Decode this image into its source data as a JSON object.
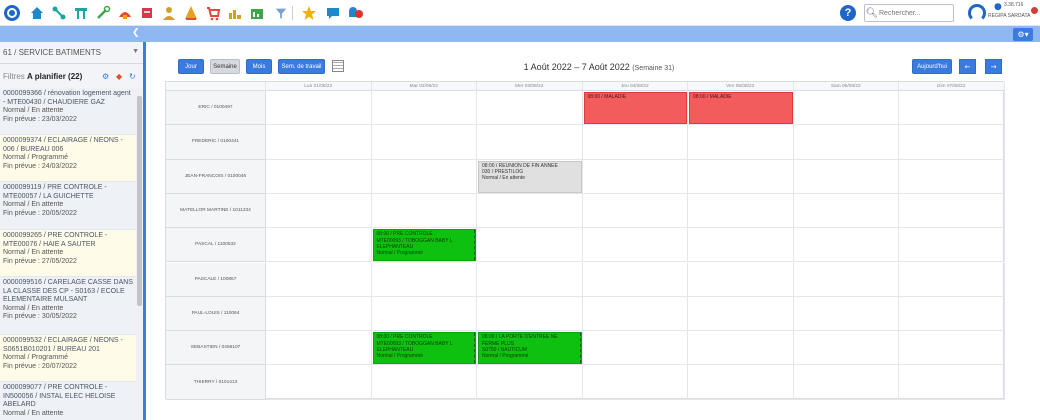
{
  "search": {
    "placeholder": "Rechercher..."
  },
  "user": {
    "version": "3.38.716",
    "name": "REGIPA   SARDATA"
  },
  "sidebar": {
    "service": "61 / SERVICE BATIMENTS",
    "filter_prefix": "Filtres",
    "filter_label": "A planifier (22)",
    "tasks": [
      {
        "title": "0000099366 / rénovation logement agent - MTE00430 / CHAUDIERE GAZ",
        "status": "Normal / En attente",
        "end": "Fin prévue : 23/03/2022"
      },
      {
        "title": "0000099374 / ECLAIRAGE / NEONS - 006 / BUREAU 006",
        "status": "Normal / Programmé",
        "end": "Fin prévue : 24/03/2022"
      },
      {
        "title": "0000099119 / PRE CONTROLE - MTE00057 / LA GUICHETTE",
        "status": "Normal / En attente",
        "end": "Fin prévue : 20/05/2022"
      },
      {
        "title": "0000099265 / PRE CONTROLE - MTE00076 / HAIE A SAUTER",
        "status": "Normal / En attente",
        "end": "Fin prévue : 27/05/2022"
      },
      {
        "title": "0000099516 / CARELAGE CASSE DANS LA CLASSE DES CP - S0163 / ECOLE ELEMENTAIRE MULSANT",
        "status": "Normal / En attente",
        "end": "Fin prévue : 30/05/2022"
      },
      {
        "title": "0000099532 / ECLAIRAGE / NEONS - S0651B010201 / BUREAU 201",
        "status": "Normal / Programmé",
        "end": "Fin prévue : 20/07/2022"
      },
      {
        "title": "0000099077 / PRE CONTROLE - IN500056 / INSTAL ELEC HELOISE ABELARD",
        "status": "Normal / En attente",
        "end": ""
      }
    ]
  },
  "toolbar": {
    "view_jour": "Jour",
    "view_semaine": "Semaine",
    "view_mois": "Mois",
    "view_sem_travail": "Sem. de travail",
    "period": "1 Août 2022 – 7 Août 2022",
    "week": "(Semaine 31)",
    "today": "Aujourd'hui",
    "prev": "←",
    "next": "→"
  },
  "calendar": {
    "days": [
      "Lun 01/08/22",
      "Mar 02/08/22",
      "Mer 03/08/22",
      "Jeu 04/08/22",
      "Ven 05/08/22",
      "Sam 06/08/22",
      "Dim 07/08/22"
    ],
    "resources": [
      "ERIC / 0100497",
      "FREDERIC / 0100441",
      "JEAN-FRANCOIS / 0100046",
      "MATELLOR MARTINE / 1011234",
      "PASCAL / 1100532",
      "PASCALE / 100857",
      "PAUL-LOUIS / 110064",
      "SEBASTIEN / 0456107",
      "THIERRY / 0101413"
    ],
    "events": [
      {
        "resource": 0,
        "day": 3,
        "color": "red",
        "lines": [
          "08:00 / MALADIE"
        ]
      },
      {
        "resource": 0,
        "day": 4,
        "color": "red",
        "lines": [
          "08:00 / MALADIE"
        ]
      },
      {
        "resource": 2,
        "day": 2,
        "color": "gray",
        "lines": [
          "08:00 / REUNION DE FIN ANNEE",
          "030 / PRESTILOG",
          "Normal / En attente"
        ]
      },
      {
        "resource": 4,
        "day": 1,
        "color": "green",
        "lines": [
          "08:00 / PRE CONTROLE",
          "MTE00093 / TOBOGGAN BABY L",
          "ELEPHANTEAU",
          "Normal / Programmé"
        ]
      },
      {
        "resource": 7,
        "day": 1,
        "color": "green",
        "lines": [
          "08:00 / PRE CONTROLE",
          "MTE00093 / TOBOGGAN BABY L",
          "ELEPHANTEAU",
          "Normal / Programmé"
        ]
      },
      {
        "resource": 7,
        "day": 2,
        "color": "green",
        "lines": [
          "08:00 / LA PORTE D'ENTREE NE",
          "FERME PLUS",
          "S0750 / NAUTICUM",
          "Normal / Programmé"
        ]
      }
    ]
  },
  "colors": {
    "accent": "#3a7be0",
    "band": "#8fb8f2",
    "red": "#f25c5c",
    "green": "#0fc10f",
    "gray": "#e0e0e0"
  },
  "icons": [
    "logo-icon",
    "home-icon",
    "network-icon",
    "asset-icon",
    "tools-icon",
    "intervention-icon",
    "stock-icon",
    "people-icon",
    "alert-icon",
    "purchase-icon",
    "reporting-icon",
    "dashboard-icon",
    "filter-icon",
    "star-icon",
    "chat-icon",
    "bell-icon"
  ]
}
